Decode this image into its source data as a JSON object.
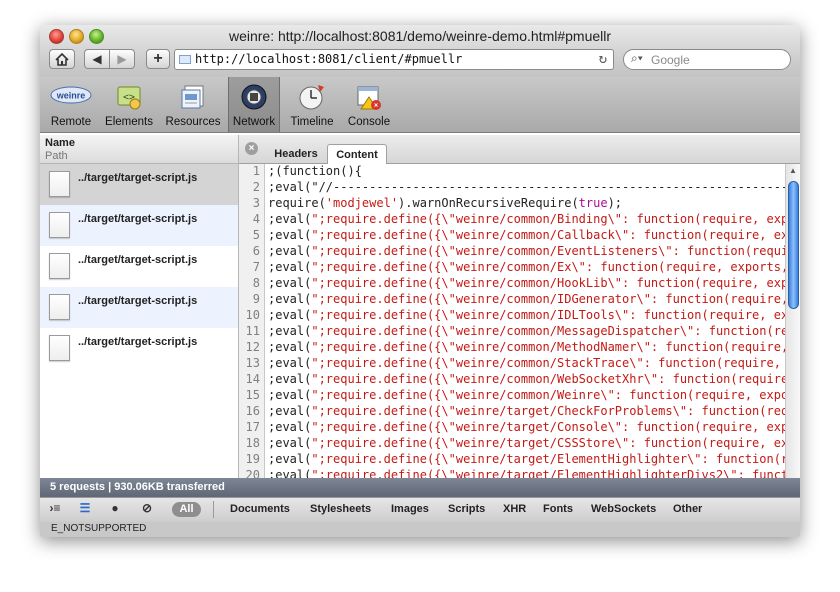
{
  "window": {
    "title": "weinre: http://localhost:8081/demo/weinre-demo.html#pmuellr"
  },
  "navbar": {
    "home_icon": "house-icon",
    "back_icon": "triangle-left-icon",
    "forward_icon": "triangle-right-icon",
    "add_icon": "plus-icon",
    "url": "http://localhost:8081/client/#pmuellr",
    "reload_icon": "reload-icon",
    "search_placeholder": "Google"
  },
  "toolbar": {
    "items": [
      {
        "label": "Remote",
        "icon": "weinre-logo-icon"
      },
      {
        "label": "Elements",
        "icon": "elements-icon"
      },
      {
        "label": "Resources",
        "icon": "resources-icon"
      },
      {
        "label": "Network",
        "icon": "network-icon",
        "selected": true
      },
      {
        "label": "Timeline",
        "icon": "timeline-icon"
      },
      {
        "label": "Console",
        "icon": "console-icon"
      }
    ]
  },
  "network": {
    "columns": {
      "name": "Name",
      "path": "Path"
    },
    "requests": [
      "../target/target-script.js",
      "../target/target-script.js",
      "../target/target-script.js",
      "../target/target-script.js",
      "../target/target-script.js"
    ],
    "summary": "5 requests  |  930.06KB transferred"
  },
  "detail": {
    "tabs": [
      "Headers",
      "Content"
    ],
    "active_tab": "Content"
  },
  "code_lines": [
    [
      {
        "t": ";(function(){"
      }
    ],
    [
      {
        "t": ";eval(\"//-----------------------------------------------------------------------"
      }
    ],
    [
      {
        "t": "require("
      },
      {
        "t": "'modjewel'",
        "c": "str"
      },
      {
        "t": ").warnOnRecursiveRequire("
      },
      {
        "t": "true",
        "c": "kw"
      },
      {
        "t": ");"
      }
    ],
    [
      {
        "t": ";eval("
      },
      {
        "t": "\";require.define({\\\"weinre/common/Binding\\\": function(require, expor",
        "c": "str"
      }
    ],
    [
      {
        "t": ";eval("
      },
      {
        "t": "\";require.define({\\\"weinre/common/Callback\\\": function(require, expo",
        "c": "str"
      }
    ],
    [
      {
        "t": ";eval("
      },
      {
        "t": "\";require.define({\\\"weinre/common/EventListeners\\\": function(require",
        "c": "str"
      }
    ],
    [
      {
        "t": ";eval("
      },
      {
        "t": "\";require.define({\\\"weinre/common/Ex\\\": function(require, exports, m",
        "c": "str"
      }
    ],
    [
      {
        "t": ";eval("
      },
      {
        "t": "\";require.define({\\\"weinre/common/HookLib\\\": function(require, expo",
        "c": "str"
      }
    ],
    [
      {
        "t": ";eval("
      },
      {
        "t": "\";require.define({\\\"weinre/common/IDGenerator\\\": function(require, e",
        "c": "str"
      }
    ],
    [
      {
        "t": ";eval("
      },
      {
        "t": "\";require.define({\\\"weinre/common/IDLTools\\\": function(require, expo",
        "c": "str"
      }
    ],
    [
      {
        "t": ";eval("
      },
      {
        "t": "\";require.define({\\\"weinre/common/MessageDispatcher\\\": function(requ",
        "c": "str"
      }
    ],
    [
      {
        "t": ";eval("
      },
      {
        "t": "\";require.define({\\\"weinre/common/MethodNamer\\\": function(require, e",
        "c": "str"
      }
    ],
    [
      {
        "t": ";eval("
      },
      {
        "t": "\";require.define({\\\"weinre/common/StackTrace\\\": function(require, ex",
        "c": "str"
      }
    ],
    [
      {
        "t": ";eval("
      },
      {
        "t": "\";require.define({\\\"weinre/common/WebSocketXhr\\\": function(require,",
        "c": "str"
      }
    ],
    [
      {
        "t": ";eval("
      },
      {
        "t": "\";require.define({\\\"weinre/common/Weinre\\\": function(require, export",
        "c": "str"
      }
    ],
    [
      {
        "t": ";eval("
      },
      {
        "t": "\";require.define({\\\"weinre/target/CheckForProblems\\\": function(requi",
        "c": "str"
      }
    ],
    [
      {
        "t": ";eval("
      },
      {
        "t": "\";require.define({\\\"weinre/target/Console\\\": function(require, expor",
        "c": "str"
      }
    ],
    [
      {
        "t": ";eval("
      },
      {
        "t": "\";require.define({\\\"weinre/target/CSSStore\\\": function(require, expo",
        "c": "str"
      }
    ],
    [
      {
        "t": ";eval("
      },
      {
        "t": "\";require.define({\\\"weinre/target/ElementHighlighter\\\": function(req",
        "c": "str"
      }
    ],
    [
      {
        "t": ";eval("
      },
      {
        "t": "\";require.define({\\\"weinre/target/ElementHighlighterDivs2\\\": functio",
        "c": "str"
      }
    ]
  ],
  "filterbar": {
    "all_label": "All",
    "filters": [
      "Documents",
      "Stylesheets",
      "Images",
      "Scripts",
      "XHR",
      "Fonts",
      "WebSockets",
      "Other"
    ]
  },
  "error_text": "E_NOTSUPPORTED"
}
